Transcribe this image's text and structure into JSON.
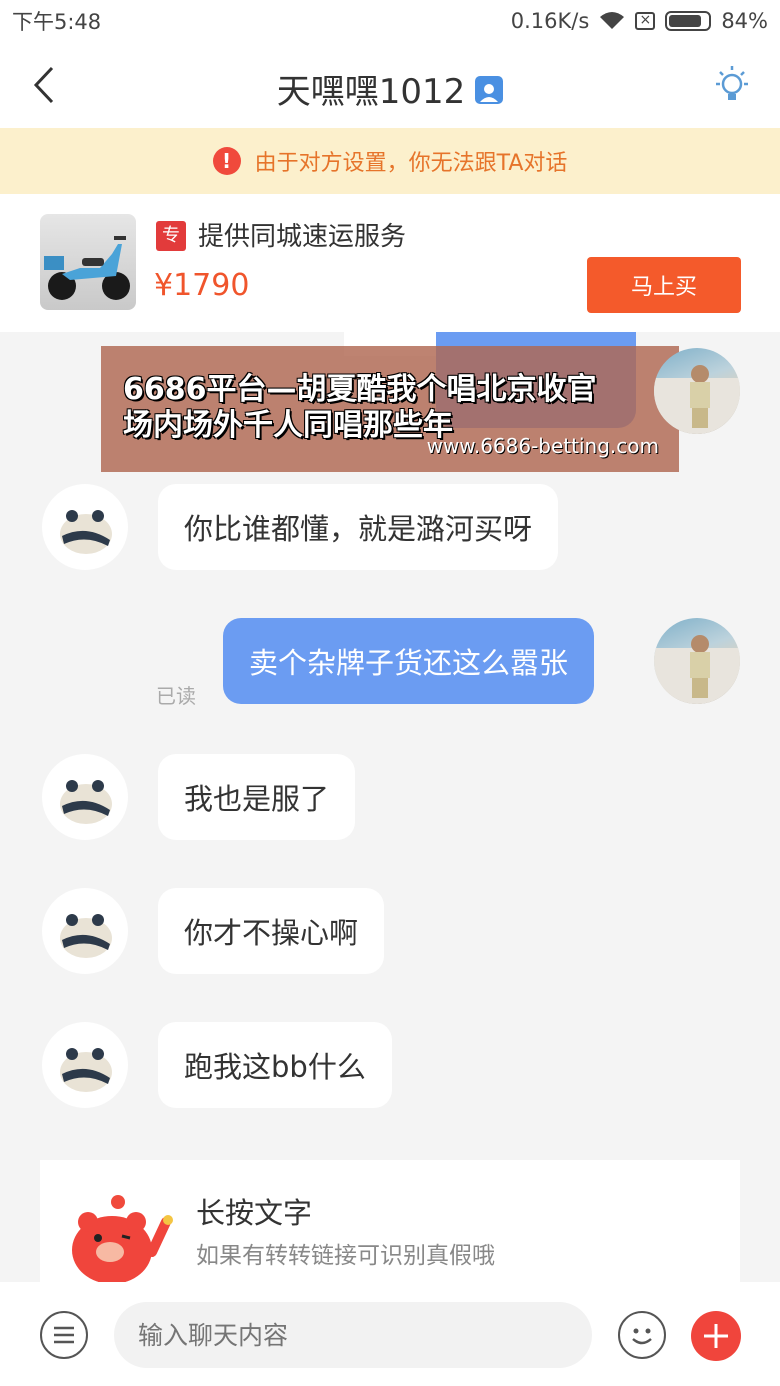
{
  "status_bar": {
    "time": "下午5:48",
    "speed": "0.16K/s",
    "battery": "84%",
    "battery_level": 0.84
  },
  "nav": {
    "title": "天嘿嘿1012"
  },
  "notice": {
    "text": "由于对方设置，你无法跟TA对话"
  },
  "product": {
    "tag": "专",
    "title": "提供同城速运服务",
    "price": "¥1790",
    "buy_label": "马上买"
  },
  "watermark": {
    "line1": "6686平台—胡夏酷我个唱北京收官",
    "line2": "场内场外千人同唱那些年",
    "url": "www.6686-betting.com"
  },
  "messages": [
    {
      "side": "in",
      "text": "你比谁都懂，就是潞河买呀"
    },
    {
      "side": "out",
      "text": "卖个杂牌子货还这么嚣张",
      "status": "已读"
    },
    {
      "side": "in",
      "text": "我也是服了"
    },
    {
      "side": "in",
      "text": "你才不操心啊"
    },
    {
      "side": "in",
      "text": "跑我这bb什么"
    }
  ],
  "tip": {
    "title": "长按文字",
    "subtitle": "如果有转转链接可识别真假哦"
  },
  "input_bar": {
    "placeholder": "输入聊天内容"
  },
  "colors": {
    "accent": "#f45a2b",
    "bubble_out": "#6b9cf2",
    "notice_bg": "#fcf0cc",
    "notice_text": "#e6742a"
  },
  "icons": [
    "back-icon",
    "verified-icon",
    "bulb-icon",
    "warning-icon",
    "menu-icon",
    "emoji-icon",
    "plus-icon"
  ]
}
